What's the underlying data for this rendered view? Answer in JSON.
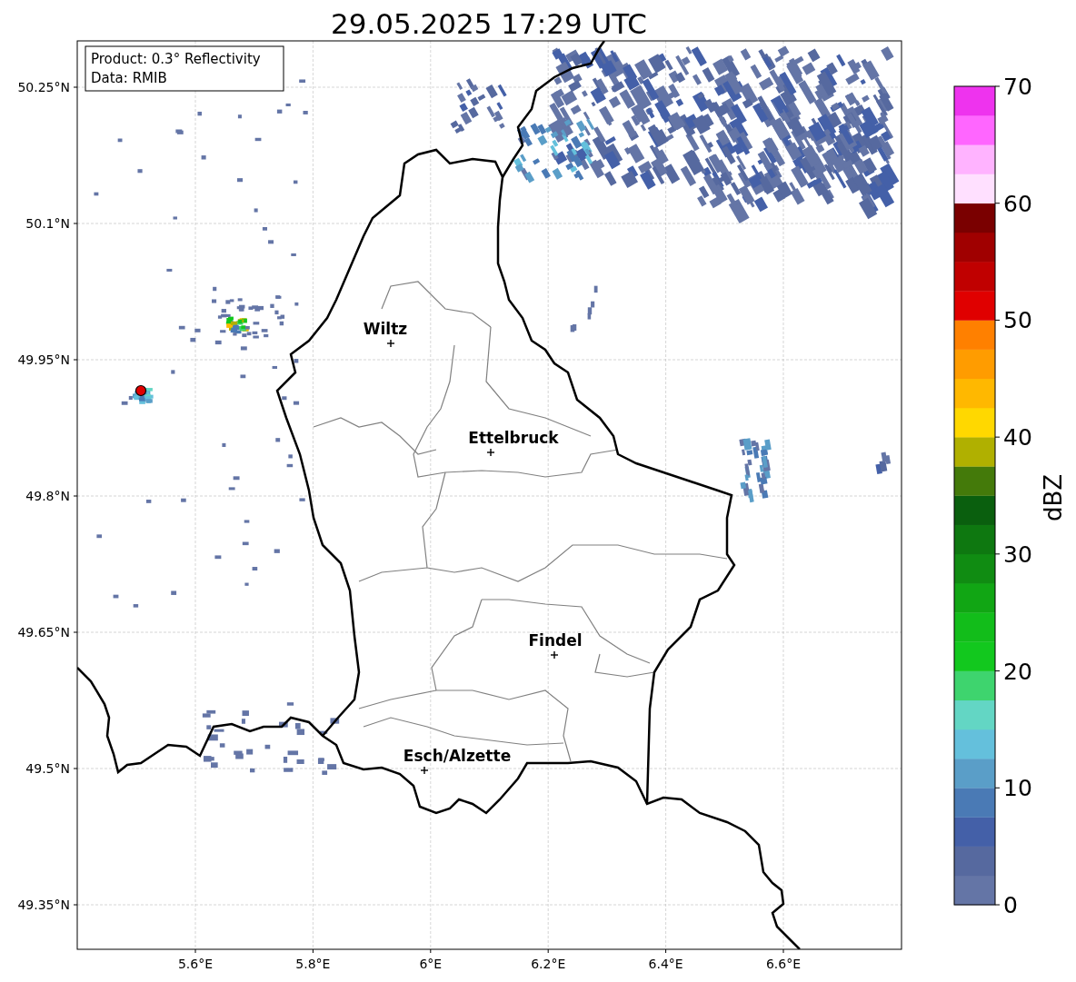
{
  "title": "29.05.2025 17:29 UTC",
  "info": {
    "product": "Product: 0.3° Reflectivity",
    "source": "Data: RMIB"
  },
  "lat_ticks": [
    "50.25°N",
    "50.1°N",
    "49.95°N",
    "49.8°N",
    "49.65°N",
    "49.5°N",
    "49.35°N"
  ],
  "lon_ticks": [
    "5.6°E",
    "5.8°E",
    "6°E",
    "6.2°E",
    "6.4°E",
    "6.6°E"
  ],
  "cities": [
    {
      "name": "Wiltz"
    },
    {
      "name": "Ettelbruck"
    },
    {
      "name": "Findel"
    },
    {
      "name": "Esch/Alzette"
    }
  ],
  "colorbar": {
    "label": "dBZ",
    "ticks": [
      "70",
      "60",
      "50",
      "40",
      "30",
      "20",
      "10",
      "0"
    ],
    "bands": [
      {
        "color": "#6475a6"
      },
      {
        "color": "#56699f"
      },
      {
        "color": "#4460a8"
      },
      {
        "color": "#4a7ab5"
      },
      {
        "color": "#5a9ec8"
      },
      {
        "color": "#64c0dc"
      },
      {
        "color": "#63d6c4"
      },
      {
        "color": "#3ed46e"
      },
      {
        "color": "#12c81e"
      },
      {
        "color": "#12bd1a"
      },
      {
        "color": "#11a614"
      },
      {
        "color": "#108c12"
      },
      {
        "color": "#0e7810"
      },
      {
        "color": "#0a5f0e"
      },
      {
        "color": "#447a0a"
      },
      {
        "color": "#b0b000"
      },
      {
        "color": "#ffd800"
      },
      {
        "color": "#ffb800"
      },
      {
        "color": "#ff9c00"
      },
      {
        "color": "#ff8000"
      },
      {
        "color": "#e00000"
      },
      {
        "color": "#c00000"
      },
      {
        "color": "#a00000"
      },
      {
        "color": "#7a0000"
      },
      {
        "color": "#ffe0ff"
      },
      {
        "color": "#ffb3ff"
      },
      {
        "color": "#ff66ff"
      },
      {
        "color": "#ee33ee"
      }
    ]
  }
}
